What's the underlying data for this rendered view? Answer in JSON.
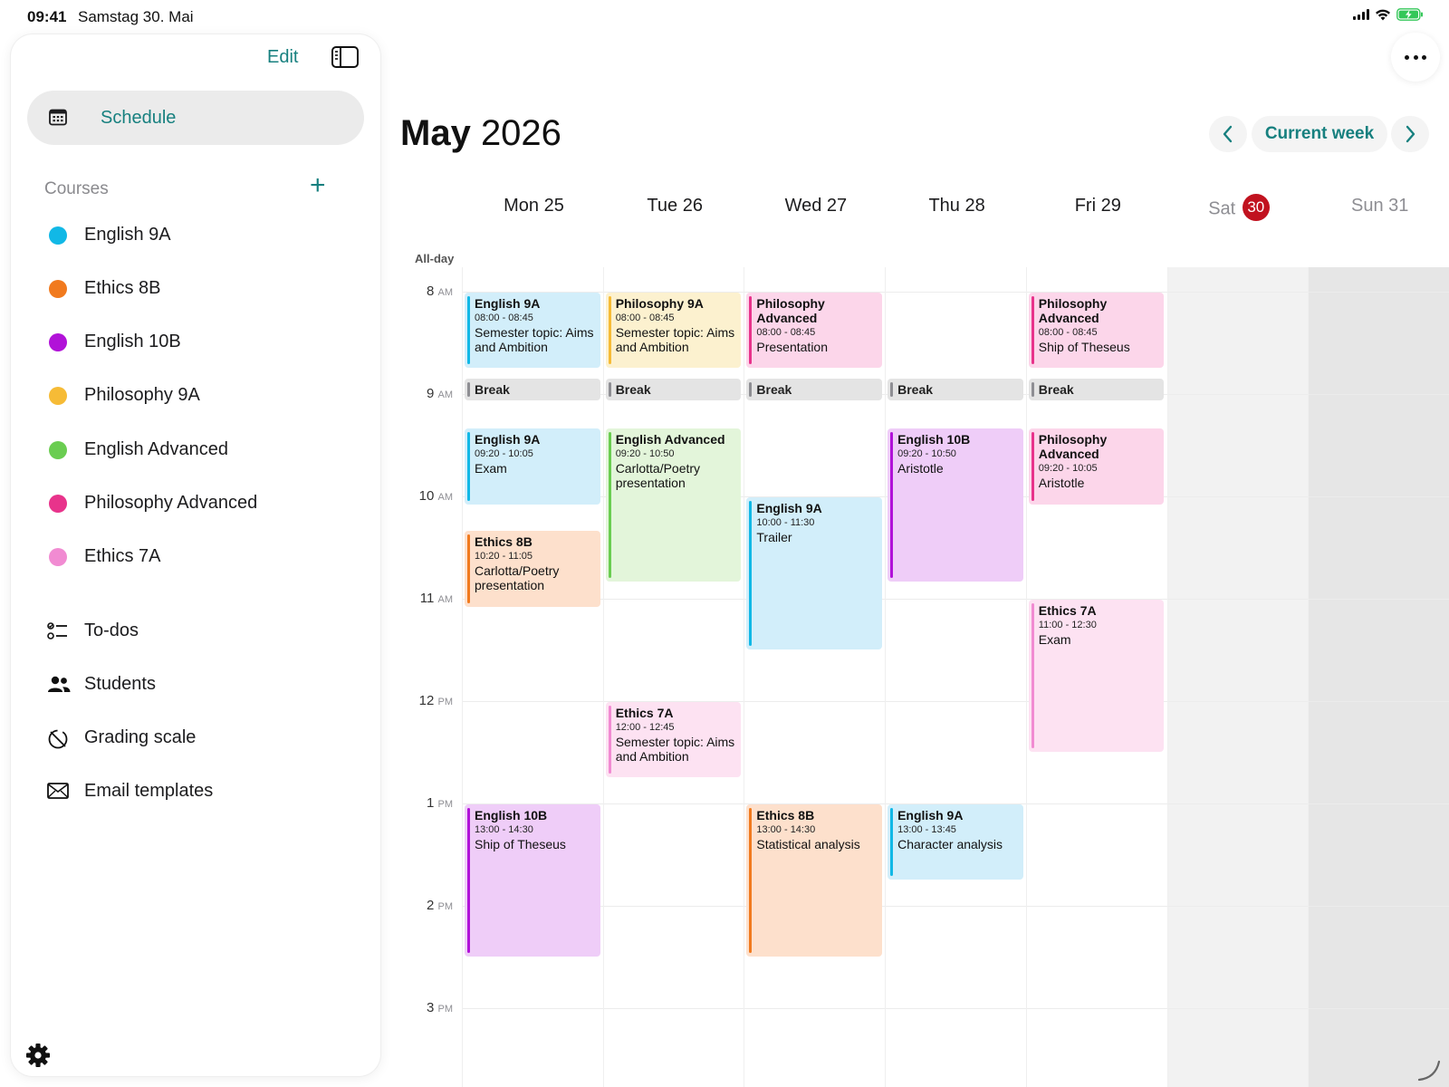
{
  "status_bar": {
    "time": "09:41",
    "date": "Samstag 30. Mai"
  },
  "sidebar": {
    "edit_label": "Edit",
    "schedule_label": "Schedule",
    "courses_title": "Courses",
    "courses_add": "+",
    "courses": [
      {
        "label": "English 9A",
        "color": "#11b8e6"
      },
      {
        "label": "Ethics 8B",
        "color": "#f17a1e"
      },
      {
        "label": "English 10B",
        "color": "#b112d8"
      },
      {
        "label": "Philosophy 9A",
        "color": "#f6bb36"
      },
      {
        "label": "English Advanced",
        "color": "#6acd51"
      },
      {
        "label": "Philosophy Advanced",
        "color": "#e8338b"
      },
      {
        "label": "Ethics 7A",
        "color": "#f18bd2"
      }
    ],
    "nav": [
      {
        "label": "To-dos",
        "icon": "checklist-icon"
      },
      {
        "label": "Students",
        "icon": "people-icon"
      },
      {
        "label": "Grading scale",
        "icon": "grading-scale-icon"
      },
      {
        "label": "Email templates",
        "icon": "envelope-icon"
      }
    ]
  },
  "header": {
    "month": "May",
    "year": "2026",
    "current_week_label": "Current week"
  },
  "calendar": {
    "all_day_label": "All-day",
    "days": [
      {
        "name": "Mon",
        "num": "25",
        "weekend": false,
        "today": false
      },
      {
        "name": "Tue",
        "num": "26",
        "weekend": false,
        "today": false
      },
      {
        "name": "Wed",
        "num": "27",
        "weekend": false,
        "today": false
      },
      {
        "name": "Thu",
        "num": "28",
        "weekend": false,
        "today": false
      },
      {
        "name": "Fri",
        "num": "29",
        "weekend": false,
        "today": false
      },
      {
        "name": "Sat",
        "num": "30",
        "weekend": true,
        "today": true
      },
      {
        "name": "Sun",
        "num": "31",
        "weekend": true,
        "today": false
      }
    ],
    "hours": [
      {
        "num": "8",
        "ampm": "AM"
      },
      {
        "num": "9",
        "ampm": "AM"
      },
      {
        "num": "10",
        "ampm": "AM"
      },
      {
        "num": "11",
        "ampm": "AM"
      },
      {
        "num": "12",
        "ampm": "PM"
      },
      {
        "num": "1",
        "ampm": "PM"
      },
      {
        "num": "2",
        "ampm": "PM"
      },
      {
        "num": "3",
        "ampm": "PM"
      }
    ],
    "break_label": "Break",
    "breaks": [
      0,
      1,
      2,
      3,
      4
    ],
    "events": [
      {
        "day": 0,
        "start": "08:00",
        "end": "08:45",
        "title": "English 9A",
        "time": "08:00 - 08:45",
        "desc": "Semester topic: Aims and Ambition",
        "color": "cyan"
      },
      {
        "day": 1,
        "start": "08:00",
        "end": "08:45",
        "title": "Philosophy 9A",
        "time": "08:00 - 08:45",
        "desc": "Semester topic: Aims and Ambition",
        "color": "yellow"
      },
      {
        "day": 2,
        "start": "08:00",
        "end": "08:45",
        "title": "Philosophy Advanced",
        "time": "08:00 - 08:45",
        "desc": "Presentation",
        "color": "pink"
      },
      {
        "day": 4,
        "start": "08:00",
        "end": "08:45",
        "title": "Philosophy Advanced",
        "time": "08:00 - 08:45",
        "desc": "Ship of Theseus",
        "color": "pink"
      },
      {
        "day": 0,
        "start": "09:20",
        "end": "10:05",
        "title": "English 9A",
        "time": "09:20 - 10:05",
        "desc": "Exam",
        "color": "cyan"
      },
      {
        "day": 1,
        "start": "09:20",
        "end": "10:50",
        "title": "English Advanced",
        "time": "09:20 - 10:50",
        "desc": "Carlotta/Poetry presentation",
        "color": "green"
      },
      {
        "day": 3,
        "start": "09:20",
        "end": "10:50",
        "title": "English 10B",
        "time": "09:20 - 10:50",
        "desc": "Aristotle",
        "color": "purple"
      },
      {
        "day": 4,
        "start": "09:20",
        "end": "10:05",
        "title": "Philosophy Advanced",
        "time": "09:20 - 10:05",
        "desc": "Aristotle",
        "color": "pink"
      },
      {
        "day": 2,
        "start": "10:00",
        "end": "11:30",
        "title": "English 9A",
        "time": "10:00 - 11:30",
        "desc": "Trailer",
        "color": "cyan"
      },
      {
        "day": 0,
        "start": "10:20",
        "end": "11:05",
        "title": "Ethics 8B",
        "time": "10:20 - 11:05",
        "desc": "Carlotta/Poetry presentation",
        "color": "orange"
      },
      {
        "day": 4,
        "start": "11:00",
        "end": "12:30",
        "title": "Ethics 7A",
        "time": "11:00 - 12:30",
        "desc": "Exam",
        "color": "lpink"
      },
      {
        "day": 1,
        "start": "12:00",
        "end": "12:45",
        "title": "Ethics 7A",
        "time": "12:00 - 12:45",
        "desc": "Semester topic: Aims and Ambition",
        "color": "lpink"
      },
      {
        "day": 0,
        "start": "13:00",
        "end": "14:30",
        "title": "English 10B",
        "time": "13:00 - 14:30",
        "desc": "Ship of Theseus",
        "color": "purple"
      },
      {
        "day": 2,
        "start": "13:00",
        "end": "14:30",
        "title": "Ethics 8B",
        "time": "13:00 - 14:30",
        "desc": "Statistical analysis",
        "color": "orange"
      },
      {
        "day": 3,
        "start": "13:00",
        "end": "13:45",
        "title": "English 9A",
        "time": "13:00 - 13:45",
        "desc": "Character analysis",
        "color": "cyan"
      }
    ]
  }
}
